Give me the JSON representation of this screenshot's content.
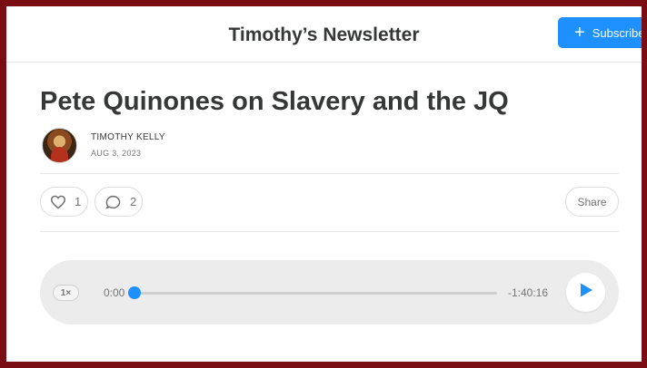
{
  "header": {
    "publication_title": "Timothy’s Newsletter",
    "subscribe_label": "Subscribe"
  },
  "post": {
    "title": "Pete Quinones on Slavery and the JQ",
    "author": "TIMOTHY KELLY",
    "date": "AUG 3, 2023"
  },
  "actions": {
    "like_count": "1",
    "comment_count": "2",
    "share_label": "Share"
  },
  "player": {
    "speed": "1×",
    "elapsed": "0:00",
    "remaining": "-1:40:16",
    "progress": 0.0,
    "accent_color": "#1e90ff"
  },
  "colors": {
    "frame": "#7a0c14",
    "accent": "#1e90ff",
    "title_text": "#363737"
  },
  "icons": {
    "subscribe": "plus-icon",
    "like": "heart-icon",
    "comment": "comment-bubble-icon",
    "play": "play-icon"
  }
}
